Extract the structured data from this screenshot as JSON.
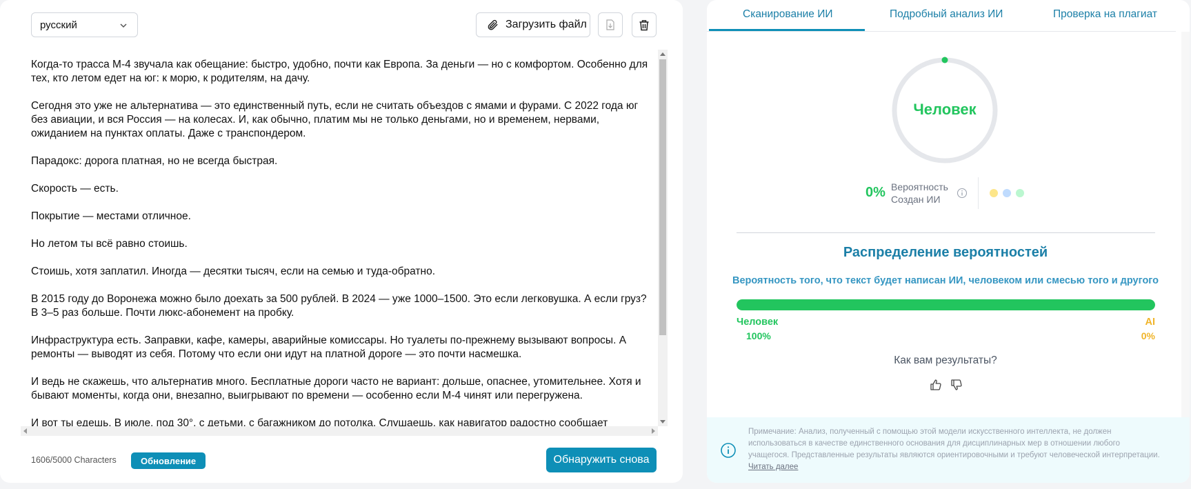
{
  "editor": {
    "language": "русский",
    "upload_label": "Загрузить файл",
    "paragraphs": [
      "Когда-то трасса М-4 звучала как обещание: быстро, удобно, почти как Европа. За деньги — но с комфортом. Особенно для тех, кто летом едет на юг: к морю, к родителям, на дачу.",
      "Сегодня это уже не альтернатива — это единственный путь, если не считать объездов с ямами и фурами. С 2022 года юг без авиации, и вся Россия — на колесах. И, как обычно, платим мы не только деньгами, но и временем, нервами, ожиданием на пунктах оплаты. Даже с транспондером.",
      "Парадокс: дорога платная, но не всегда быстрая.",
      "Скорость — есть.",
      "Покрытие — местами отличное.",
      "Но летом ты всё равно стоишь.",
      "Стоишь, хотя заплатил. Иногда — десятки тысяч, если на семью и туда-обратно.",
      "В 2015 году до Воронежа можно было доехать за 500 рублей. В 2024 — уже 1000–1500. Это если легковушка. А если груз? В 3–5 раз больше. Почти люкс-абонемент на пробку.",
      "Инфраструктура есть. Заправки, кафе, камеры, аварийные комиссары. Но туалеты по-прежнему вызывают вопросы. А ремонты — выводят из себя. Потому что если они идут на платной дороге — это почти насмешка.",
      "И ведь не скажешь, что альтернатив много. Бесплатные дороги часто не вариант: дольше, опаснее, утомительнее. Хотя и бывают моменты, когда они, внезапно, выигрывают по времени — особенно если М-4 чинят или перегружена.",
      "И вот ты едешь. В июле, под 30°, с детьми, с багажником до потолка. Слушаешь, как навигатор радостно сообщает"
    ],
    "char_count": "1606/5000 Characters",
    "update_label": "Обновление",
    "detect_again_label": "Обнаружить снова"
  },
  "results": {
    "tabs": [
      "Сканирование ИИ",
      "Подробный анализ ИИ",
      "Проверка на плагиат"
    ],
    "active_tab": 0,
    "verdict": "Человек",
    "ai_probability": "0%",
    "ai_probability_label_line1": "Вероятность",
    "ai_probability_label_line2": "Создан ИИ",
    "distribution_title": "Распределение вероятностей",
    "distribution_subtitle": "Вероятность того, что текст будет написан ИИ, человеком или смесью того и другого",
    "human_label": "Человек",
    "human_percent": "100%",
    "human_fraction": 1.0,
    "ai_label": "AI",
    "ai_percent": "0%",
    "feedback_question": "Как вам результаты?",
    "note_text": "Примечание: Анализ, полученный с помощью этой модели искусственного интеллекта, не должен использоваться в качестве единственного основания для дисциплинарных мер в отношении любого учащегося. Представленные результаты являются ориентировочными и требуют человеческой интерпретации.",
    "note_link": "Читать далее"
  },
  "colors": {
    "accent": "#0e8fb7",
    "human_green": "#22c55e",
    "ai_yellow": "#f0b429",
    "dot_yellow": "#fde68a",
    "dot_blue": "#bfdbfe",
    "dot_green": "#bbf7d0"
  },
  "icons": {
    "upload": "paperclip-icon",
    "export": "file-export-icon",
    "delete": "trash-icon",
    "info": "info-icon",
    "like": "thumbs-up-icon",
    "dislike": "thumbs-down-icon"
  }
}
